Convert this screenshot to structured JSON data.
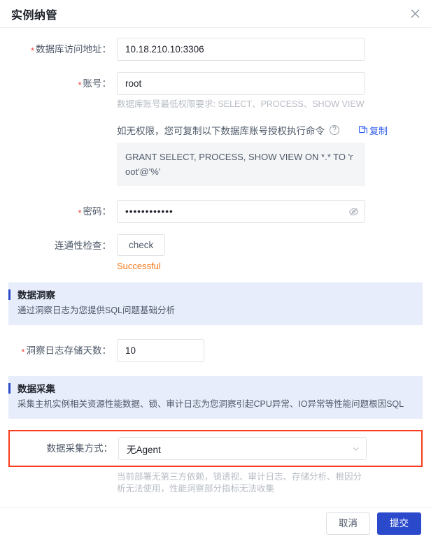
{
  "dialog": {
    "title": "实例纳管",
    "close_icon": "close-icon"
  },
  "form": {
    "db_address": {
      "label": "数据库访问地址：",
      "required": true,
      "value": "10.18.210.10:3306",
      "placeholder": ""
    },
    "account": {
      "label": "账号：",
      "required": true,
      "value": "root",
      "placeholder": "",
      "hint": "数据库账号最低权限要求: SELECT、PROCESS、SHOW VIEW"
    },
    "grant": {
      "prompt": "如无权限，您可复制以下数据库账号授权执行命令",
      "help_icon": "question-mark-icon",
      "copy_label": "复制",
      "copy_icon": "copy-icon",
      "command": "GRANT SELECT, PROCESS, SHOW VIEW ON *.* TO 'root'@'%'"
    },
    "password": {
      "label": "密码：",
      "required": true,
      "value": "••••••••••••",
      "eye_icon": "eye-off-icon"
    },
    "connectivity": {
      "label": "连通性检查：",
      "required": false,
      "button_label": "check",
      "status": "Successful"
    }
  },
  "insight_section": {
    "title": "数据洞察",
    "desc": "通过洞察日志为您提供SQL问题基础分析",
    "retention": {
      "label": "洞察日志存储天数：",
      "required": true,
      "value": "10"
    }
  },
  "collection_section": {
    "title": "数据采集",
    "desc": "采集主机实例相关资源性能数据、锁、审计日志为您洞察引起CPU异常、IO异常等性能问题根因SQL",
    "method": {
      "label": "数据采集方式：",
      "required": false,
      "value": "无Agent",
      "chevron_icon": "chevron-down-icon",
      "hint": "当前部署无第三方依赖，锁透视、审计日志、存储分析、根因分析无法使用，性能洞察部分指标无法收集"
    }
  },
  "footer": {
    "cancel_label": "取消",
    "submit_label": "提交"
  },
  "colors": {
    "accent_blue": "#2b4acb",
    "banner_bg": "#e8edfb",
    "highlight_red": "#fa3b1d",
    "status_orange": "#f5761a",
    "required_red": "#f53f3f"
  }
}
